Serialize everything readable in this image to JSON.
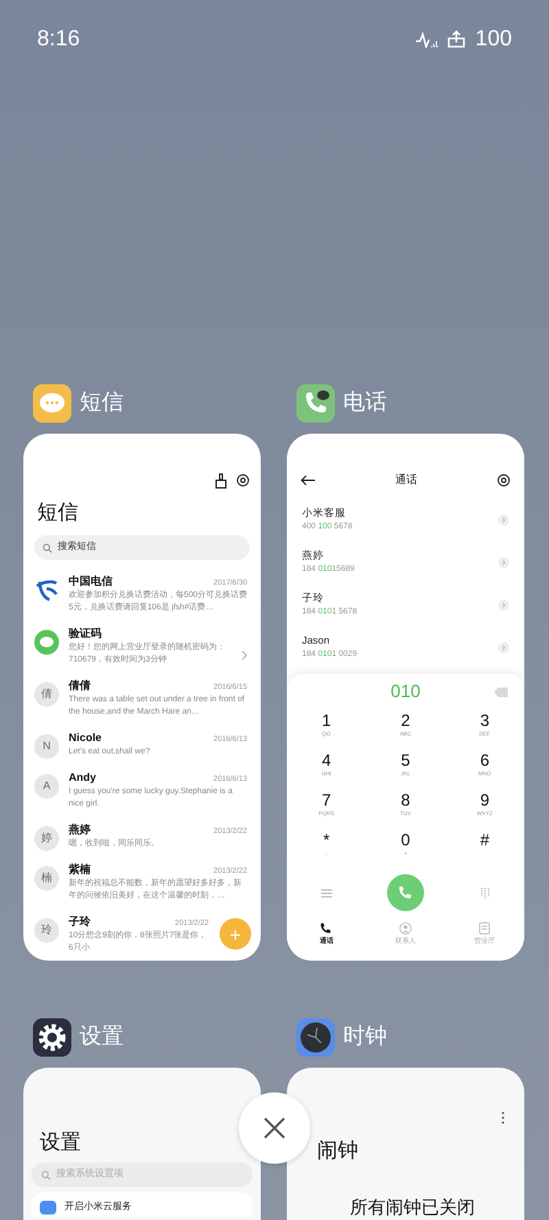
{
  "status_bar": {
    "time": "8:16",
    "battery": "100"
  },
  "sms_app": {
    "name": "短信",
    "title": "短信",
    "search_placeholder": "搜索短信",
    "fab": "+",
    "messages": [
      {
        "sender": "中国电信",
        "kind": "telecom",
        "date": "2017/6/30",
        "preview": "欢迎参加积分兑换话费活动，每500分可兑换话费5元，兑换话费请回复106是 jfsh#话费…"
      },
      {
        "sender": "验证码",
        "kind": "service",
        "preview": "您好！您的网上营业厅登录的随机密码为：710679，有效时间为3分钟"
      },
      {
        "sender": "倩倩",
        "kind": "contact",
        "avatar": "倩",
        "date": "2016/6/15",
        "preview": "There was a table set out under a tree in front of the house,and the March Hare an…"
      },
      {
        "sender": "Nicole",
        "kind": "contact",
        "avatar": "N",
        "date": "2016/6/13",
        "preview": "Let's eat out,shall we?"
      },
      {
        "sender": "Andy",
        "kind": "contact",
        "avatar": "A",
        "date": "2016/6/13",
        "preview": "I guess you're some lucky guy.Stephanie is a nice girl."
      },
      {
        "sender": "燕婷",
        "kind": "contact",
        "avatar": "婷",
        "date": "2013/2/22",
        "preview": "嗯，收到啦，同乐同乐。"
      },
      {
        "sender": "紫楠",
        "kind": "contact",
        "avatar": "楠",
        "date": "2013/2/22",
        "preview": "新年的祝福总不能数，新年的愿望好多好多，新年的问候依旧美好，在这个温馨的时刻，…"
      },
      {
        "sender": "子玲",
        "kind": "contact",
        "avatar": "玲",
        "date": "2013/2/22",
        "preview": "10分想念9刻的你，8张照片7张是你，6只小"
      }
    ]
  },
  "phone_app": {
    "name": "电话",
    "title": "通话",
    "contacts": [
      {
        "name": "小米客服",
        "number": [
          {
            "text": "400 ",
            "match": false
          },
          {
            "text": "100",
            "match": true
          },
          {
            "text": " 5678",
            "match": false
          }
        ]
      },
      {
        "name": "燕婷",
        "number": [
          {
            "text": "184 ",
            "match": false
          },
          {
            "text": "010",
            "match": true
          },
          {
            "text": "15689",
            "match": false
          }
        ]
      },
      {
        "name": "子玲",
        "number": [
          {
            "text": "184 ",
            "match": false
          },
          {
            "text": "010",
            "match": true
          },
          {
            "text": "1 5678",
            "match": false
          }
        ]
      },
      {
        "name": "Jason",
        "number": [
          {
            "text": "184 ",
            "match": false
          },
          {
            "text": "010",
            "match": true
          },
          {
            "text": "1 0029",
            "match": false
          }
        ]
      }
    ],
    "dialed": "010",
    "keys": [
      {
        "digit": "1",
        "letters": "QO"
      },
      {
        "digit": "2",
        "letters": "ABC"
      },
      {
        "digit": "3",
        "letters": "DEF"
      },
      {
        "digit": "4",
        "letters": "GHI"
      },
      {
        "digit": "5",
        "letters": "JKL"
      },
      {
        "digit": "6",
        "letters": "MNO"
      },
      {
        "digit": "7",
        "letters": "PQRS"
      },
      {
        "digit": "8",
        "letters": "TUV"
      },
      {
        "digit": "9",
        "letters": "WXYZ"
      },
      {
        "digit": "*",
        "letters": ","
      },
      {
        "digit": "0",
        "letters": "+"
      },
      {
        "digit": "#"
      }
    ],
    "tabs": [
      {
        "label": "通话",
        "kind": "calls",
        "selected": true
      },
      {
        "label": "联系人",
        "kind": "contacts",
        "selected": false
      },
      {
        "label": "营业厅",
        "kind": "store",
        "selected": false
      }
    ]
  },
  "settings_app": {
    "name": "设置",
    "title": "设置",
    "search_placeholder": "搜索系统设置项",
    "items": [
      "开启小米云服务"
    ]
  },
  "clock_app": {
    "name": "时钟",
    "title": "闹钟",
    "status": "所有闹钟已关闭"
  }
}
